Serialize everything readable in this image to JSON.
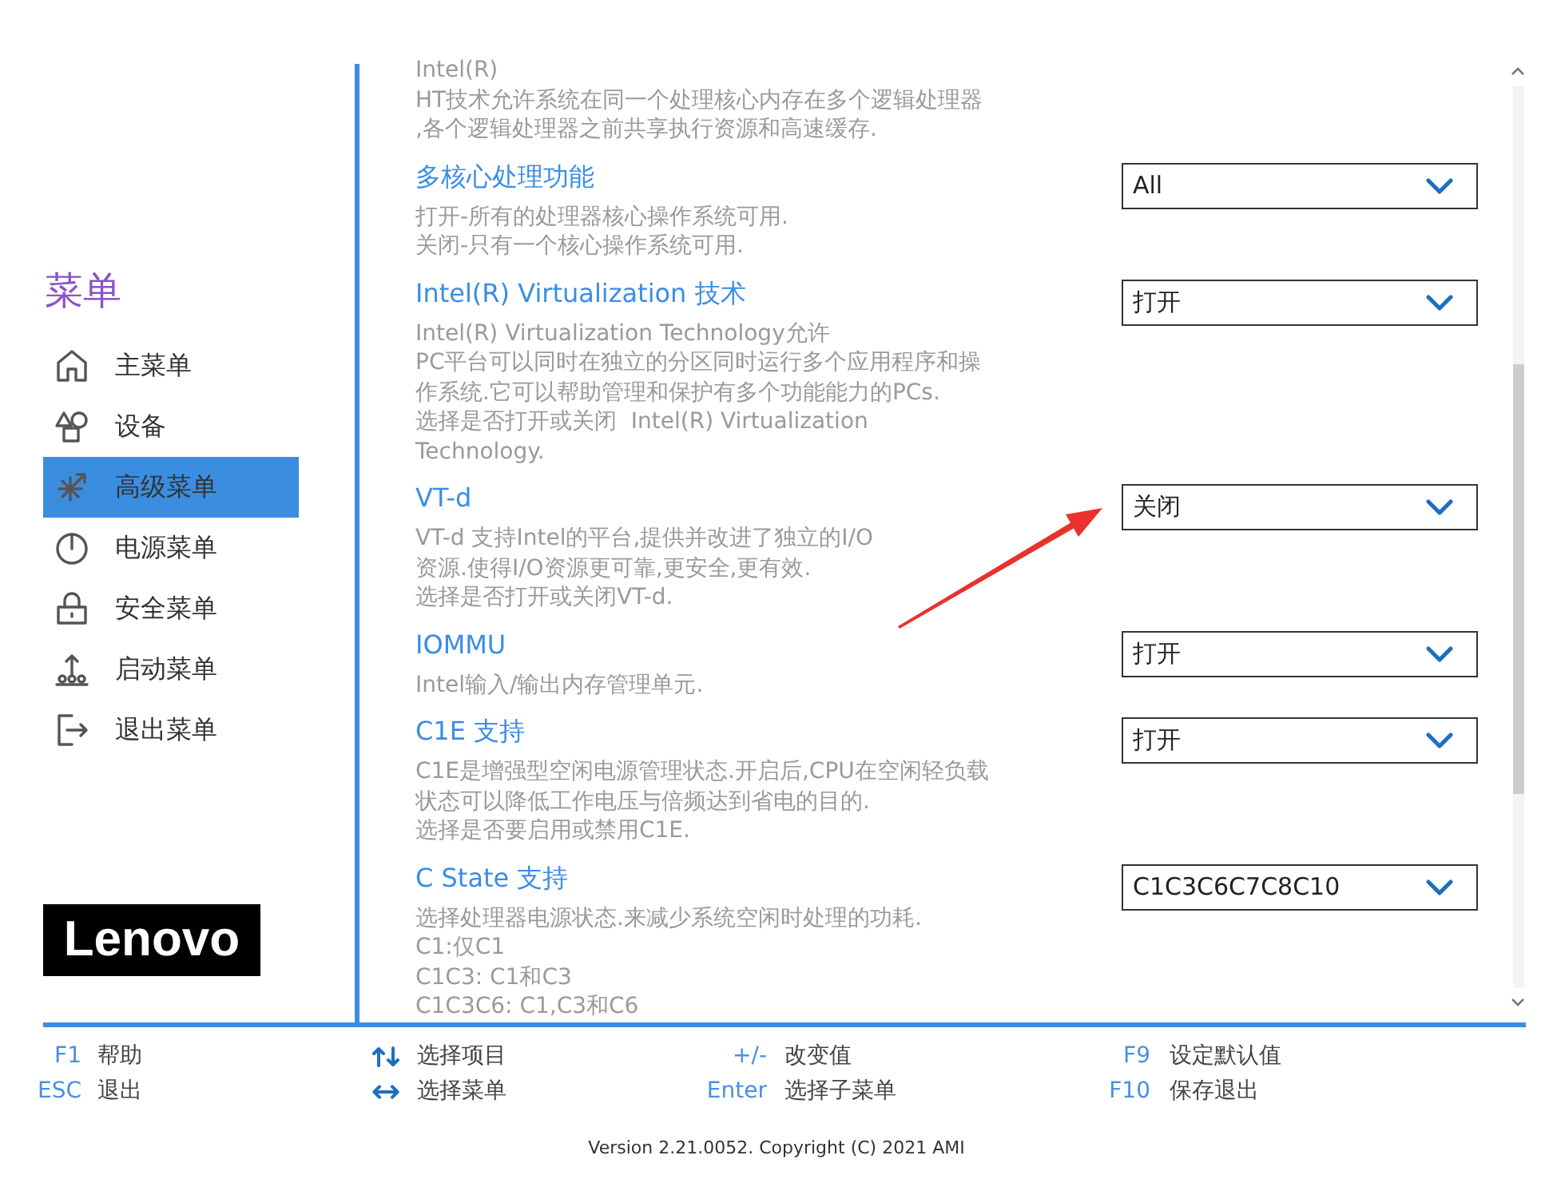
{
  "sidebar": {
    "title": "菜单",
    "items": [
      {
        "label": "主菜单",
        "selected": false
      },
      {
        "label": "设备",
        "selected": false
      },
      {
        "label": "高级菜单",
        "selected": true
      },
      {
        "label": "电源菜单",
        "selected": false
      },
      {
        "label": "安全菜单",
        "selected": false
      },
      {
        "label": "启动菜单",
        "selected": false
      },
      {
        "label": "退出菜单",
        "selected": false
      }
    ],
    "logo": "Lenovo"
  },
  "settings": [
    {
      "description": [
        "Intel(R)",
        "HT技术允许系统在同一个处理核心内存在多个逻辑处理器",
        ",各个逻辑处理器之前共享执行资源和高速缓存."
      ]
    },
    {
      "title": "多核心处理功能",
      "description": [
        "打开-所有的处理器核心操作系统可用.",
        "关闭-只有一个核心操作系统可用."
      ],
      "value": "All"
    },
    {
      "title": "Intel(R) Virtualization 技术",
      "description": [
        "Intel(R) Virtualization Technology允许",
        "PC平台可以同时在独立的分区同时运行多个应用程序和操",
        "作系统.它可以帮助管理和保护有多个功能能力的PCs.",
        "选择是否打开或关闭  Intel(R) Virtualization",
        "Technology."
      ],
      "value": "打开"
    },
    {
      "title": "VT-d",
      "description": [
        "VT-d 支持Intel的平台,提供并改进了独立的I/O",
        "资源.使得I/O资源更可靠,更安全,更有效.",
        "选择是否打开或关闭VT-d."
      ],
      "value": "关闭"
    },
    {
      "title": "IOMMU",
      "description": [
        "Intel输入/输出内存管理单元."
      ],
      "value": "打开"
    },
    {
      "title": "C1E 支持",
      "description": [
        "C1E是增强型空闲电源管理状态.开启后,CPU在空闲轻负载",
        "状态可以降低工作电压与倍频达到省电的目的.",
        "选择是否要启用或禁用C1E."
      ],
      "value": "打开"
    },
    {
      "title": "C State 支持",
      "description": [
        "选择处理器电源状态.来减少系统空闲时处理的功耗.",
        "C1:仅C1",
        "C1C3: C1和C3",
        "C1C3C6: C1,C3和C6"
      ],
      "value": "C1C3C6C7C8C10"
    }
  ],
  "footer": {
    "columns": [
      {
        "hints": [
          {
            "kind": "key",
            "key": "F1",
            "label": "帮助"
          },
          {
            "kind": "key",
            "key": "ESC",
            "label": "退出"
          }
        ]
      },
      {
        "hints": [
          {
            "kind": "icon",
            "label": "选择项目"
          },
          {
            "kind": "icon",
            "label": "选择菜单"
          }
        ]
      },
      {
        "hints": [
          {
            "kind": "key",
            "key": "+/-",
            "label": "改变值"
          },
          {
            "kind": "key",
            "key": "Enter",
            "label": "选择子菜单"
          }
        ]
      },
      {
        "hints": [
          {
            "kind": "key",
            "key": "F9",
            "label": "设定默认值"
          },
          {
            "kind": "key",
            "key": "F10",
            "label": "保存退出"
          }
        ]
      }
    ]
  },
  "version": "Version 2.21.0052. Copyright (C) 2021 AMI"
}
